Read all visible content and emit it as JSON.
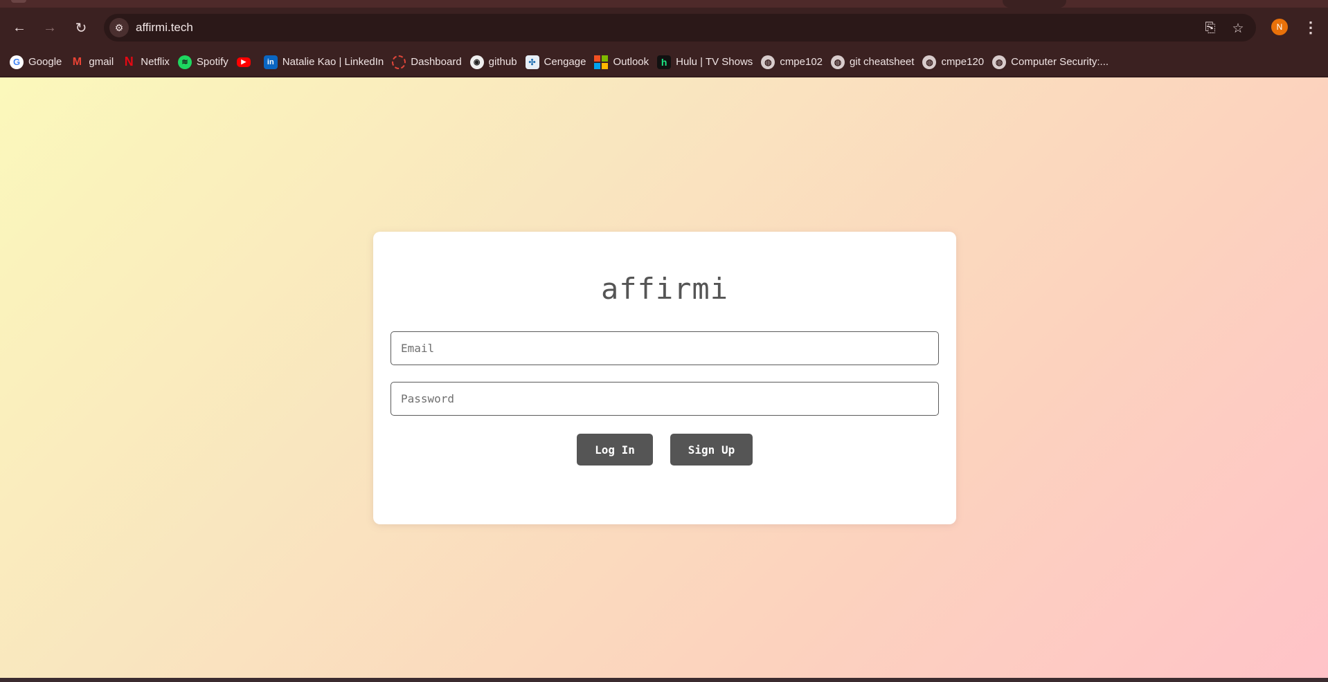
{
  "browser": {
    "url": "affirmi.tech",
    "profile_initial": "N",
    "nav": {
      "back_icon": "arrow-left-icon",
      "forward_icon": "arrow-right-icon",
      "reload_icon": "reload-icon"
    },
    "bookmarks": [
      {
        "label": "Google",
        "icon": "google-icon",
        "glyph": "G"
      },
      {
        "label": "gmail",
        "icon": "gmail-icon",
        "glyph": "M"
      },
      {
        "label": "Netflix",
        "icon": "netflix-icon",
        "glyph": "N"
      },
      {
        "label": "Spotify",
        "icon": "spotify-icon",
        "glyph": "≋"
      },
      {
        "label": "",
        "icon": "youtube-icon",
        "glyph": "▶"
      },
      {
        "label": "Natalie Kao | LinkedIn",
        "icon": "linkedin-icon",
        "glyph": "in"
      },
      {
        "label": "Dashboard",
        "icon": "dashboard-icon",
        "glyph": ""
      },
      {
        "label": "github",
        "icon": "github-icon",
        "glyph": "◉"
      },
      {
        "label": "Cengage",
        "icon": "cengage-icon",
        "glyph": "✣"
      },
      {
        "label": "Outlook",
        "icon": "outlook-icon",
        "glyph": ""
      },
      {
        "label": "Hulu | TV Shows",
        "icon": "hulu-icon",
        "glyph": "h"
      },
      {
        "label": "cmpe102",
        "icon": "globe-icon",
        "glyph": "◍"
      },
      {
        "label": "git cheatsheet",
        "icon": "globe-icon",
        "glyph": "◍"
      },
      {
        "label": "cmpe120",
        "icon": "globe-icon",
        "glyph": "◍"
      },
      {
        "label": "Computer Security:...",
        "icon": "globe-icon",
        "glyph": "◍"
      }
    ],
    "colors": {
      "chrome": "#3b2121",
      "omnibox": "#2b1818",
      "avatar": "#e8710a"
    }
  },
  "login": {
    "logo": "affirmi",
    "email_placeholder": "Email",
    "password_placeholder": "Password",
    "login_label": "Log In",
    "signup_label": "Sign Up",
    "colors": {
      "button": "#555555",
      "dot": "#e21b1b"
    }
  }
}
